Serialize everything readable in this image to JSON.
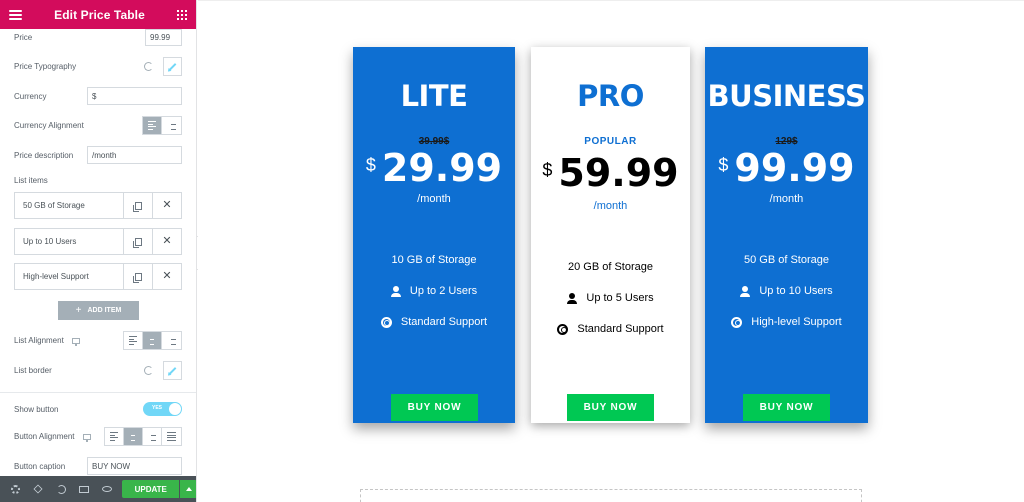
{
  "editor": {
    "title": "Edit Price Table",
    "price_label": "Price",
    "price_value": "99.99",
    "price_typography_label": "Price Typography",
    "currency_label": "Currency",
    "currency_value": "$",
    "currency_alignment_label": "Currency Alignment",
    "price_description_label": "Price description",
    "price_description_value": "/month",
    "list_items_label": "List items",
    "list_items": [
      {
        "title": "50 GB of Storage"
      },
      {
        "title": "Up to 10 Users"
      },
      {
        "title": "High-level Support"
      }
    ],
    "add_item_label": "ADD ITEM",
    "list_alignment_label": "List Alignment",
    "list_border_label": "List border",
    "show_button_label": "Show button",
    "show_button_toggle": "YES",
    "button_alignment_label": "Button Alignment",
    "button_caption_label": "Button caption",
    "button_caption_value": "BUY NOW",
    "update_label": "UPDATE"
  },
  "pricing": {
    "plans": [
      {
        "name": "LITE",
        "old_price": "39.99$",
        "currency": "$",
        "price": "29.99",
        "period": "/month",
        "features": [
          "10 GB of Storage",
          "Up to 2 Users",
          "Standard Support"
        ],
        "button": "BUY NOW"
      },
      {
        "name": "PRO",
        "badge": "POPULAR",
        "currency": "$",
        "price": "59.99",
        "period": "/month",
        "features": [
          "20 GB of Storage",
          "Up to 5 Users",
          "Standard Support"
        ],
        "button": "BUY NOW"
      },
      {
        "name": "BUSINESS",
        "old_price": "129$",
        "currency": "$",
        "price": "99.99",
        "period": "/month",
        "features": [
          "50 GB of Storage",
          "Up to 10 Users",
          "High-level Support"
        ],
        "button": "BUY NOW"
      }
    ]
  },
  "colors": {
    "header": "#d30c5c",
    "card_blue": "#0e6fd2",
    "buy_button": "#00c853",
    "update_button": "#39b54a",
    "toggle_on": "#71d7f7"
  }
}
